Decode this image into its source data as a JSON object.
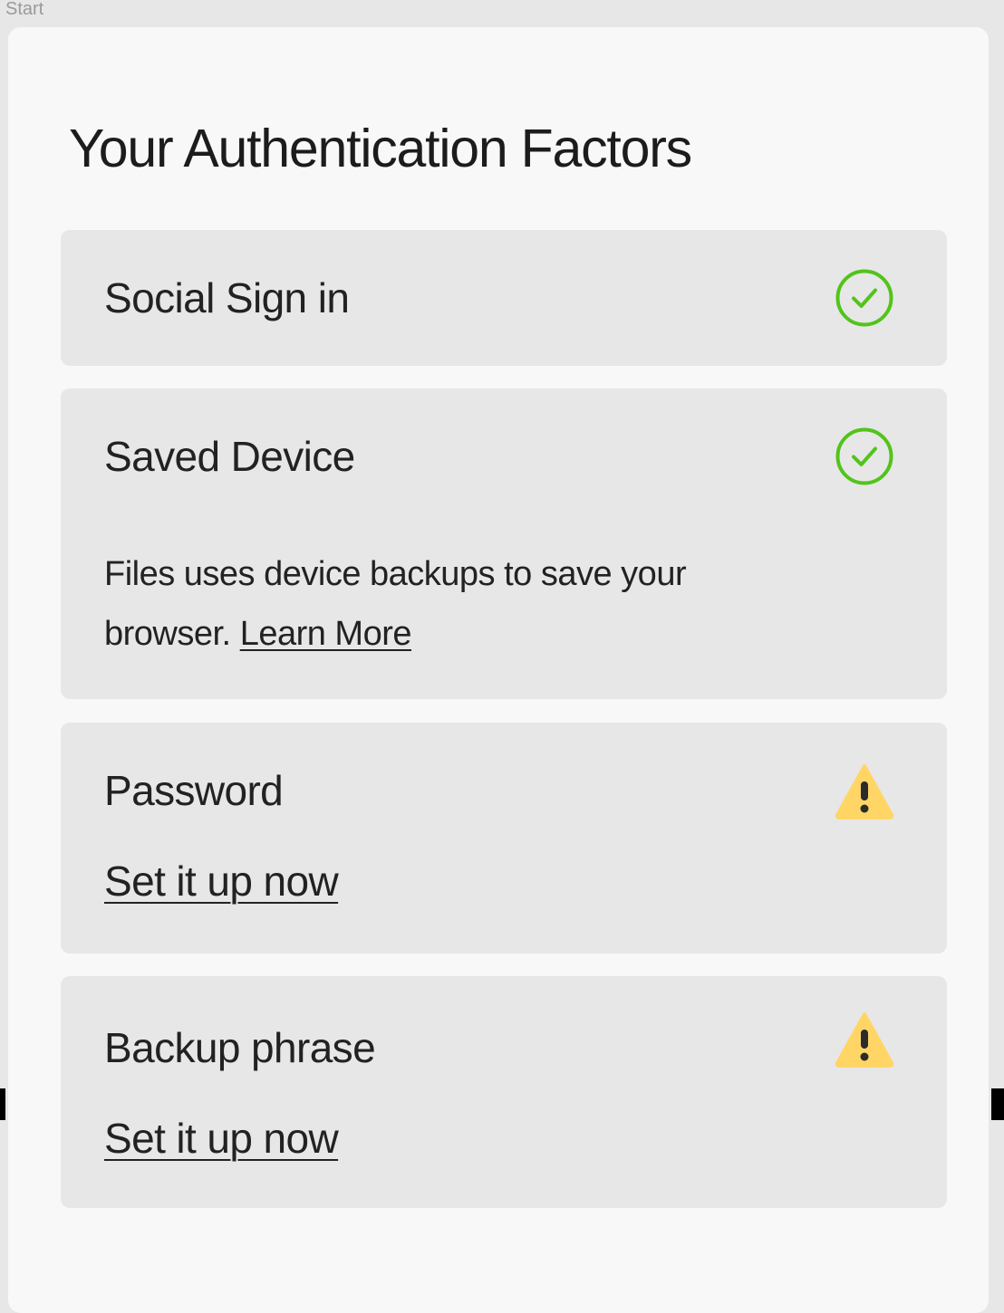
{
  "frame": {
    "label": "Start"
  },
  "title": "Your Authentication Factors",
  "colors": {
    "panel_bg": "#f8f8f8",
    "card_bg": "#e7e7e7",
    "check_green": "#52c41a",
    "warning_yellow": "#ffd666",
    "text": "#222222"
  },
  "factors": [
    {
      "name": "Social Sign in",
      "status": "complete",
      "status_icon": "check-circle-icon"
    },
    {
      "name": "Saved Device",
      "status": "complete",
      "status_icon": "check-circle-icon",
      "description": "Files uses device backups to save your browser.",
      "link": "Learn More"
    },
    {
      "name": "Password",
      "status": "warning",
      "status_icon": "warning-triangle-icon",
      "action": "Set it up now"
    },
    {
      "name": "Backup phrase",
      "status": "warning",
      "status_icon": "warning-triangle-icon",
      "action": "Set it up now"
    }
  ]
}
